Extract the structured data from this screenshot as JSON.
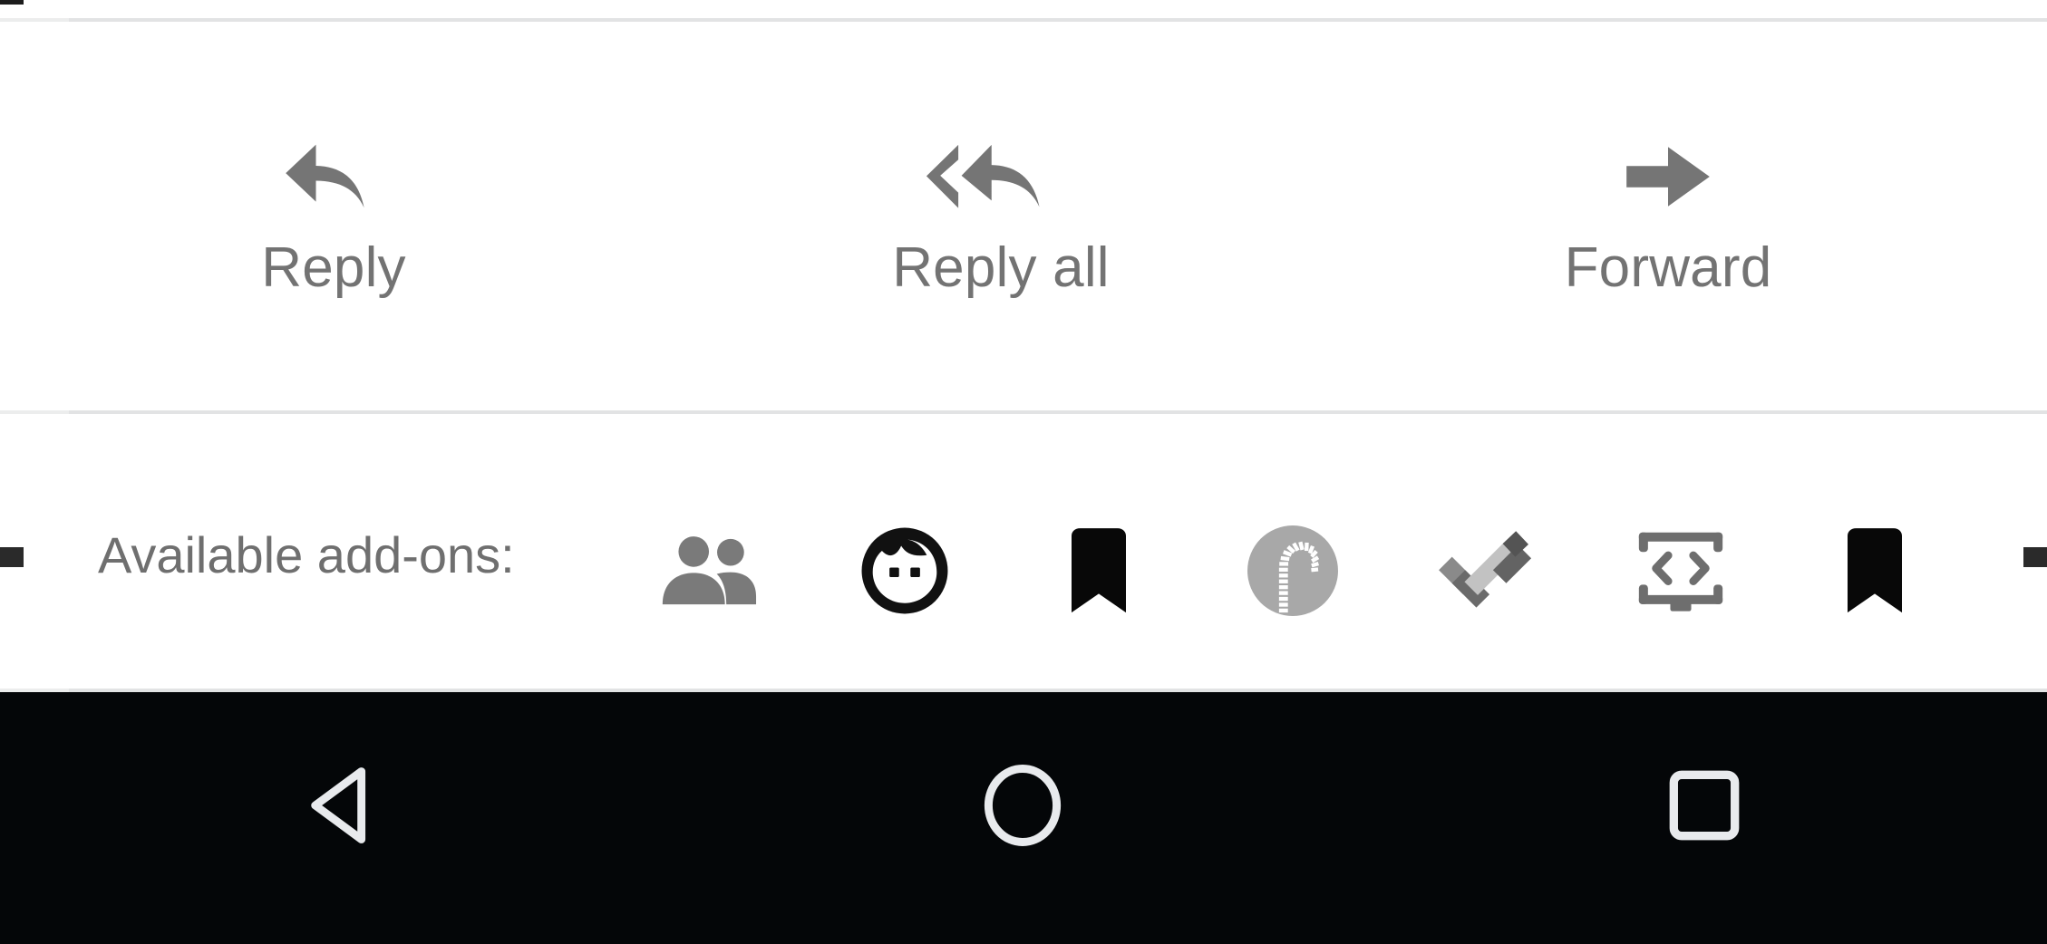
{
  "app": {
    "platform": "android",
    "screen_background": "#ffffff",
    "divider_color": "#e2e3e4",
    "muted_text_color": "#737373",
    "icon_gray": "#757575",
    "navbar_background": "#040608",
    "navbar_icon_color": "#e8eaed"
  },
  "reply_bar": {
    "actions": [
      {
        "label": "Reply",
        "icon": "reply-arrow-icon"
      },
      {
        "label": "Reply all",
        "icon": "reply-all-arrow-icon"
      },
      {
        "label": "Forward",
        "icon": "forward-arrow-icon"
      }
    ]
  },
  "addons": {
    "label": "Available add-ons:",
    "items": [
      {
        "name": "people-group-icon",
        "color": "#7a7a7a"
      },
      {
        "name": "person-face-icon",
        "color": "#111111"
      },
      {
        "name": "bookmark-icon",
        "color": "#080808"
      },
      {
        "name": "candy-cane-circle-icon",
        "color": "#a8a8a8"
      },
      {
        "name": "checkmark-icon",
        "color": "#7f7f7f"
      },
      {
        "name": "code-screen-icon",
        "color": "#6e6e6e"
      },
      {
        "name": "bookmark-icon-2",
        "color": "#080808"
      }
    ],
    "scroll_clipped_left": true,
    "scroll_clipped_right": true
  },
  "navbar": {
    "buttons": [
      {
        "label": "Back",
        "icon": "back-triangle-icon"
      },
      {
        "label": "Home",
        "icon": "home-circle-icon"
      },
      {
        "label": "Recents",
        "icon": "recents-square-icon"
      }
    ]
  }
}
